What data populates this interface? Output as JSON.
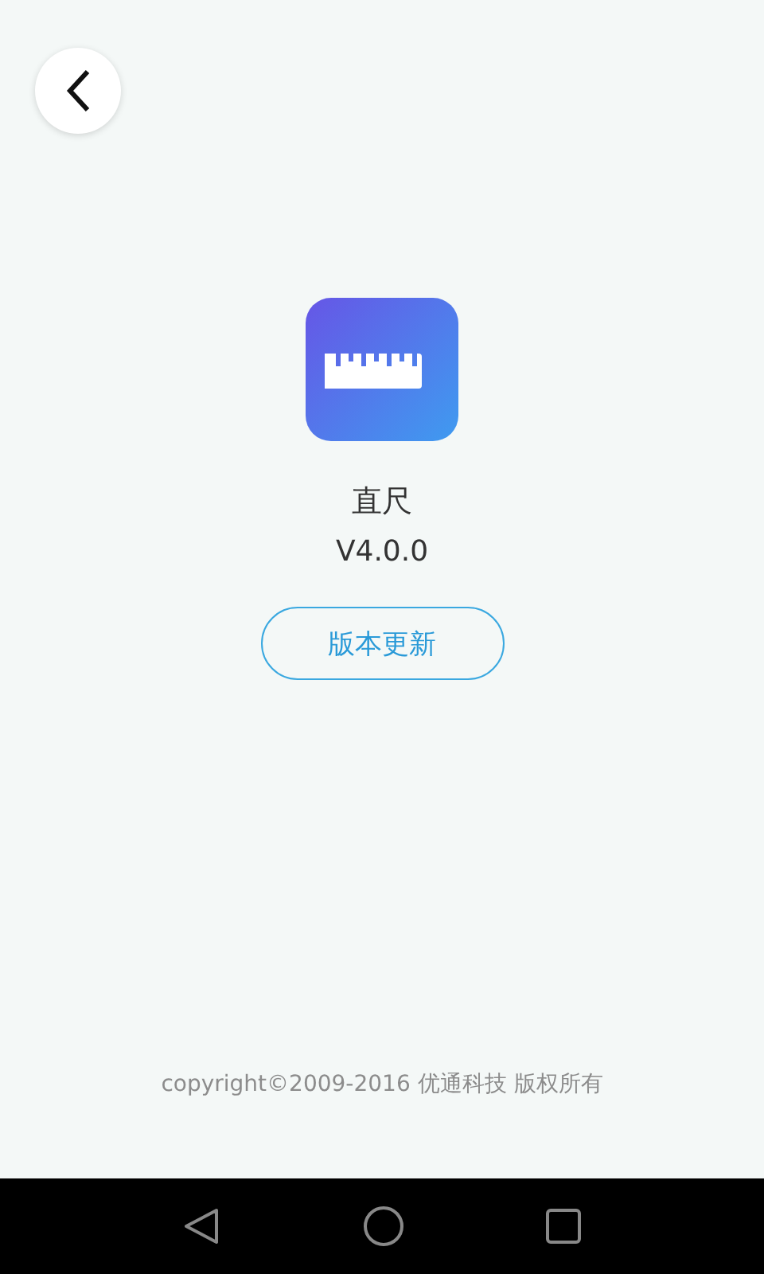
{
  "app": {
    "name": "直尺",
    "version": "V4.0.0"
  },
  "update_button": {
    "label": "版本更新"
  },
  "footer": {
    "copyright": "copyright©2009-2016 优通科技 版权所有"
  }
}
